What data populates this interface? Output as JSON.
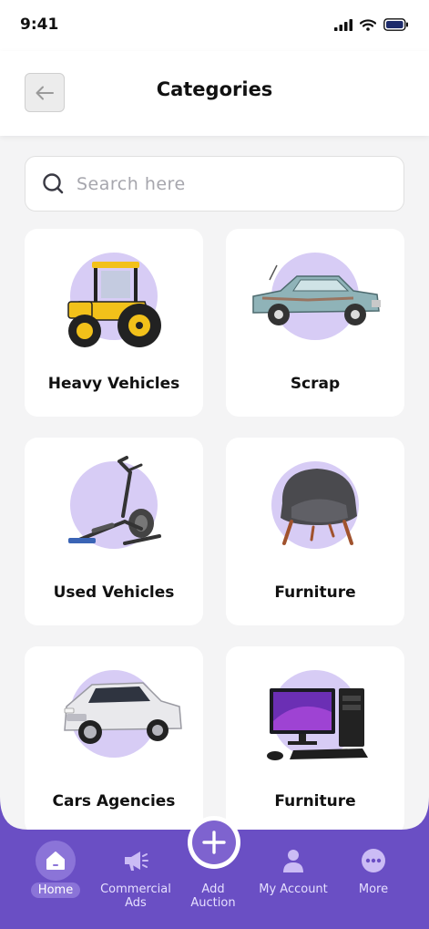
{
  "status": {
    "time": "9:41"
  },
  "header": {
    "title": "Categories"
  },
  "search": {
    "placeholder": "Search here"
  },
  "categories": [
    {
      "label": "Heavy Vehicles",
      "icon": "tractor-image"
    },
    {
      "label": "Scrap",
      "icon": "old-car-image"
    },
    {
      "label": "Used Vehicles",
      "icon": "elliptical-trainer-image"
    },
    {
      "label": "Furniture",
      "icon": "armchair-image"
    },
    {
      "label": "Cars Agencies",
      "icon": "suv-image"
    },
    {
      "label": "Furniture",
      "icon": "computer-image"
    }
  ],
  "nav": {
    "home": "Home",
    "commercial_line1": "Commercial",
    "commercial_line2": "Ads",
    "add_line1": "Add",
    "add_line2": "Auction",
    "account": "My Account",
    "more": "More"
  },
  "colors": {
    "accent": "#6a4fc4",
    "circle": "#d7ccf5",
    "background": "#f4f4f5"
  }
}
